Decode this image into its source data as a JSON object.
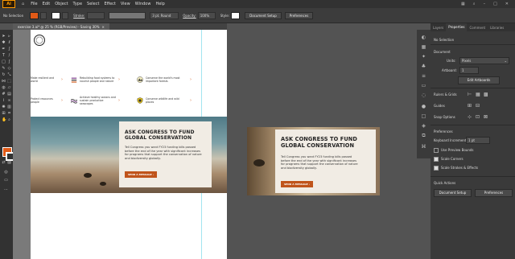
{
  "app": {
    "logo": "Ai"
  },
  "menu": [
    "File",
    "Edit",
    "Object",
    "Type",
    "Select",
    "Effect",
    "View",
    "Window",
    "Help"
  ],
  "control_bar": {
    "selection": "No Selection",
    "stroke_label": "Stroke:",
    "brush": "3 pt. Round",
    "opacity_label": "Opacity:",
    "opacity_value": "100%",
    "style_label": "Style:",
    "doc_setup": "Document Setup",
    "preferences": "Preferences",
    "fill_color": "#e15a17"
  },
  "document_tab": {
    "title": "exercise 3.ai* @ 25 % (RGB/Preview) - Saving 30%",
    "close": "×"
  },
  "features": [
    {
      "text": "Make resilient and world",
      "icon": "planet-icon"
    },
    {
      "text": "Rebuilding food systems to nourish people and nature",
      "icon": "food-icon"
    },
    {
      "text": "Conserve the world's most important forests",
      "icon": "forest-icon"
    },
    {
      "text": "Protect resources people",
      "icon": "water-icon"
    },
    {
      "text": "Achieve healthy oceans and sustain productive seascapes",
      "icon": "ocean-icon"
    },
    {
      "text": "Conserve wildlife and wild places",
      "icon": "wildlife-icon"
    }
  ],
  "hero": {
    "headline": "ASK CONGRESS TO FUND GLOBAL CONSERVATION",
    "body": "Tell Congress you want FY23 funding bills passed before the end of the year with significant increases for programs that support the conservation of nature and biodiversity globally.",
    "cta": "SEND A MESSAGE",
    "arrow": "›",
    "accent": "#c0541b"
  },
  "panel": {
    "tabs": [
      "Layers",
      "Properties",
      "Comment",
      "Libraries"
    ],
    "selection": "No Selection",
    "document_header": "Document",
    "units_label": "Units:",
    "units_value": "Pixels",
    "artboard_label": "Artboard:",
    "artboard_value": "1",
    "edit_artboards": "Edit Artboards",
    "rulers_grids": "Rulers & Grids",
    "guides": "Guides",
    "snap_options": "Snap Options",
    "preferences_header": "Preferences",
    "keyboard_increment_label": "Keyboard Increment:",
    "keyboard_increment_value": "1 pt",
    "use_preview_bounds": "Use Preview Bounds",
    "scale_corners": "Scale Corners",
    "scale_strokes": "Scale Strokes & Effects",
    "quick_actions": "Quick Actions",
    "qa_doc_setup": "Document Setup",
    "qa_preferences": "Preferences"
  }
}
